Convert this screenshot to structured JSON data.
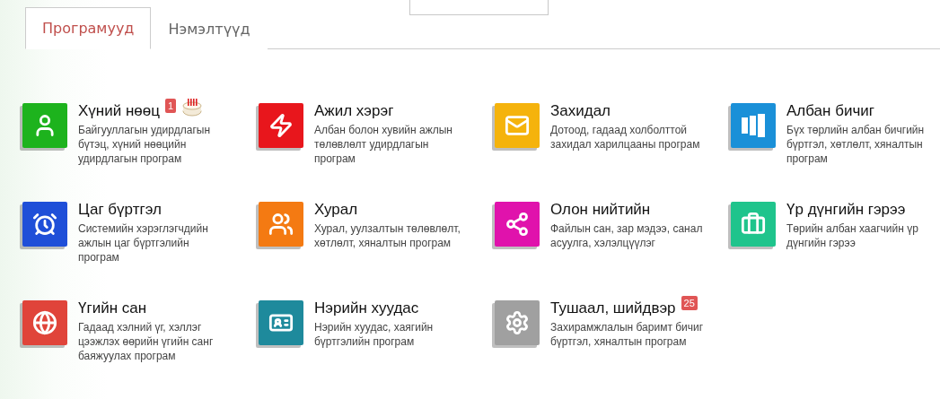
{
  "tabs": [
    {
      "label": "Програмууд",
      "selected": true
    },
    {
      "label": "Нэмэлтүүд",
      "selected": false
    }
  ],
  "apps": [
    {
      "title": "Хүний нөөц",
      "description": "Байгууллагын удирдлагын бүтэц, хүний нөөцийн удирдлагын програм",
      "kind": "person",
      "color": "#1db31d",
      "badge": "1",
      "birthday": true
    },
    {
      "title": "Ажил хэрэг",
      "description": "Албан болон хувийн ажлын төлөвлөлт удирдлагын програм",
      "kind": "bolt",
      "color": "#e8161c",
      "birthday": false
    },
    {
      "title": "Захидал",
      "description": "Дотоод, гадаад холболттой захидал харилцааны програм",
      "kind": "mail",
      "color": "#f5b30c",
      "birthday": false
    },
    {
      "title": "Албан бичиг",
      "description": "Бүх төрлийн албан бичгийн бүртгэл, хөтлөлт, хяналтын програм",
      "kind": "binders",
      "color": "#1a90d8",
      "birthday": false
    },
    {
      "title": "Цаг бүртгэл",
      "description": "Системийн хэрэглэгчдийн ажлын цаг бүртгэлийн програм",
      "kind": "clock",
      "color": "#1f4fd8",
      "birthday": false
    },
    {
      "title": "Хурал",
      "description": "Хурал, уулзалтын төлөвлөлт, хөтлөлт, хяналтын програм",
      "kind": "people",
      "color": "#f47a12",
      "birthday": false
    },
    {
      "title": "Олон нийтийн",
      "description": "Файлын сан, зар мэдээ, санал асуулга, хэлэлцүүлэг",
      "kind": "share",
      "color": "#e012ac",
      "birthday": false
    },
    {
      "title": "Үр дүнгийн гэрээ",
      "description": "Төрийн албан хаагчийн үр дүнгийн гэрээ",
      "kind": "briefcase",
      "color": "#1fc48c",
      "birthday": false
    },
    {
      "title": "Үгийн сан",
      "description": "Гадаад хэлний үг, хэллэг цээжлэх өөрийн үгийн санг баяжуулах програм",
      "kind": "globe",
      "color": "#e0443a",
      "birthday": false
    },
    {
      "title": "Нэрийн хуудас",
      "description": "Нэрийн хуудас, хаягийн бүртгэлийн програм",
      "kind": "card",
      "color": "#1e8a9c",
      "birthday": false
    },
    {
      "title": "Тушаал, шийдвэр",
      "description": "Захирамжлалын баримт бичиг бүртгэл, хяналтын програм",
      "kind": "gear",
      "color": "#a0a0a0",
      "badge": "25",
      "birthday": false
    }
  ]
}
